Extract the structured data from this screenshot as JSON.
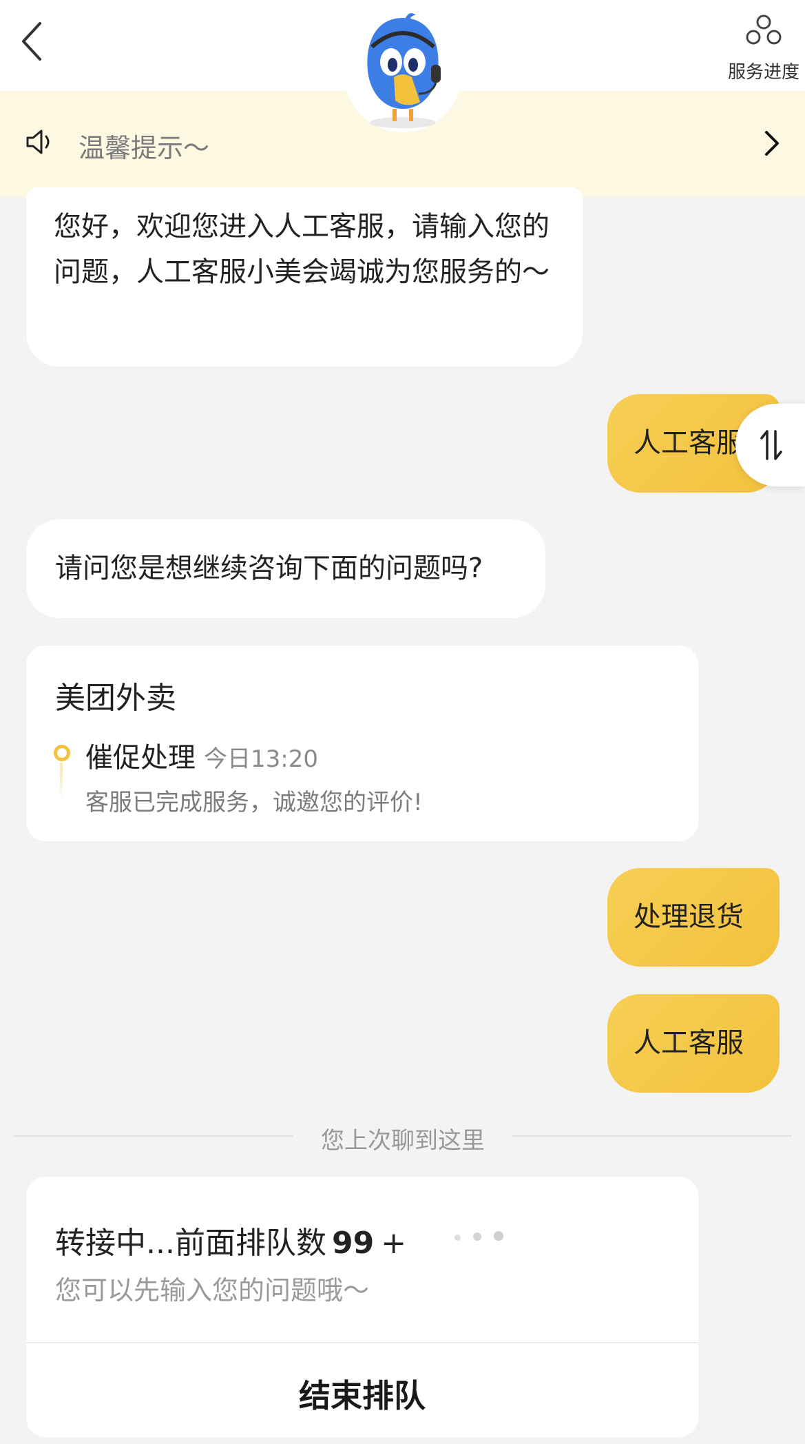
{
  "header": {
    "back_icon": "chevron-left-icon",
    "progress_label": "服务进度",
    "progress_icon": "service-progress-icon",
    "mascot": "customer-service-bird-mascot"
  },
  "notice": {
    "text": "温馨提示～",
    "icon": "speaker-icon",
    "arrow_icon": "chevron-right-icon"
  },
  "messages": {
    "welcome": "您好，欢迎您进入人工客服，请输入您的问题，人工客服小美会竭诚为您服务的～",
    "user_request_1": "人工客服",
    "ask_continue": "请问您是想继续咨询下面的问题吗?",
    "user_return": "处理退货",
    "user_request_2": "人工客服"
  },
  "order_card": {
    "title": "美团外卖",
    "status": "催促处理",
    "time": "今日13:20",
    "description": "客服已完成服务，诚邀您的评价!"
  },
  "divider": {
    "text": "您上次聊到这里"
  },
  "queue_card": {
    "status_prefix": "转接中...前面排队数",
    "count": "99",
    "plus": "+",
    "hint": "您可以先输入您的问题哦～",
    "end_button": "结束排队"
  },
  "colors": {
    "accent_yellow": "#f3c13c",
    "notice_bg": "#fcf8e1",
    "page_bg": "#f3f3f3"
  }
}
